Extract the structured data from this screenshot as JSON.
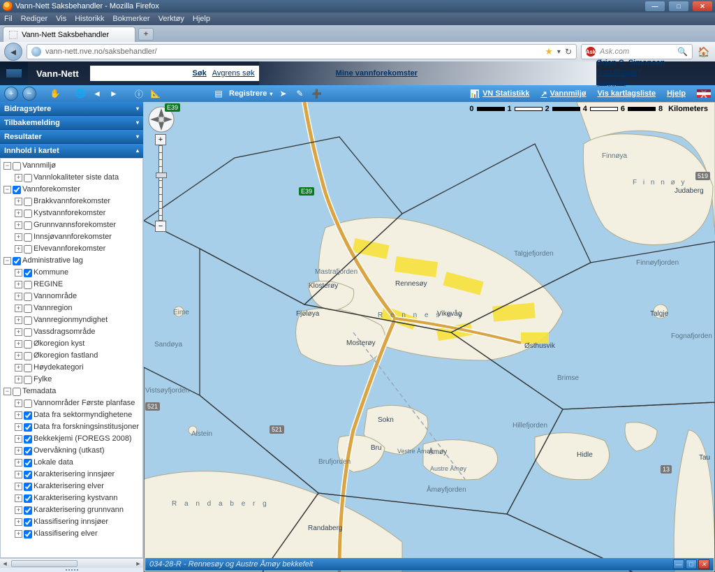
{
  "window": {
    "title": "Vann-Nett Saksbehandler - Mozilla Firefox"
  },
  "ff_menu": [
    "Fil",
    "Rediger",
    "Vis",
    "Historikk",
    "Bokmerker",
    "Verktøy",
    "Hjelp"
  ],
  "tab": {
    "title": "Vann-Nett Saksbehandler"
  },
  "url": "vann-nett.nve.no/saksbehandler/",
  "search_placeholder": "Ask.com",
  "banner": {
    "app": "Vann-Nett",
    "sok": "Søk",
    "avgrens": "Avgrens søk",
    "mine": "Mine vannforekomster"
  },
  "user": {
    "name": "Ørjan C. Simonsen",
    "settings": "Innstillinger",
    "logout": "Logg ut"
  },
  "toolbar": {
    "registrere": "Registrere",
    "vn_stat": "VN Statistikk",
    "vannmiljo": "Vannmiljø",
    "vis_kart": "Vis kartlagsliste",
    "hjelp": "Hjelp"
  },
  "accordion": {
    "bidrag": "Bidragsytere",
    "tilbake": "Tilbakemelding",
    "resultater": "Resultater",
    "innhold": "Innhold i kartet"
  },
  "tree": {
    "vannmiljo": "Vannmiljø",
    "vannlok": "Vannlokaliteter siste data",
    "vannforekomster": "Vannforekomster",
    "brakk": "Brakkvannforekomster",
    "kyst": "Kystvannforekomster",
    "grunn": "Grunnvannsforekomster",
    "innsjo": "Innsjøvannforekomster",
    "elve": "Elvevannforekomster",
    "admin": "Administrative lag",
    "kommune": "Kommune",
    "regine": "REGINE",
    "vannomrade": "Vannområde",
    "vannregion": "Vannregion",
    "vregmynd": "Vannregionmyndighet",
    "vassdrag": "Vassdragsområde",
    "okokyst": "Økoregion kyst",
    "okofastland": "Økoregion fastland",
    "hoyde": "Høydekategori",
    "fylke": "Fylke",
    "temadata": "Temadata",
    "vannomr_plan": "Vannområder Første planfase",
    "sektor": "Data fra sektormyndighetene",
    "forsk": "Data fra forskningsinstitusjoner",
    "bekke": "Bekkekjemi (FOREGS 2008)",
    "overvak": "Overvåkning (utkast)",
    "lokale": "Lokale data",
    "kar_innsjo": "Karakterisering innsjøer",
    "kar_elver": "Karakterisering elver",
    "kar_kyst": "Karakterisering kystvann",
    "kar_grunn": "Karakterisering grunnvann",
    "klas_innsjo": "Klassifisering innsjøer",
    "klas_elver": "Klassifisering elver"
  },
  "scale": {
    "ticks": [
      "0",
      "1",
      "2",
      "4",
      "6",
      "8"
    ],
    "unit": "Kilometers"
  },
  "status": {
    "text": "034-28-R - Rennesøy og Austre Åmøy bekkefelt"
  },
  "map_labels": {
    "finnoya": "Finnøya",
    "judaberg": "Judaberg",
    "finnoy": "F i n n ø y",
    "talgjefjorden": "Talgjefjorden",
    "finnoyfjorden": "Finnøyfjorden",
    "talgje": "Talgje",
    "fognafjorden": "Fognafjorden",
    "brimse": "Brimse",
    "osthusvik": "Østhusvik",
    "hillefjorden": "Hillefjorden",
    "hidle": "Hidle",
    "amoy": "Åmøy",
    "austre_amoy": "Austre Åmøy",
    "vestre_amoy": "Vestre Åmøy",
    "amoyfjorden": "Åmøyfjorden",
    "sokn": "Sokn",
    "bru": "Bru",
    "alstein": "Alstein",
    "vistsoyfjorden": "Vistsøyfjorden",
    "sandoya": "Sandøya",
    "eime": "Eime",
    "fjoloya": "Fjøløya",
    "klosteroy": "Klosterøy",
    "mastrafjorden": "Mastrafjorden",
    "rennesoy": "Rennesøy",
    "rennesoy_sp": "R e n n e s ø y",
    "vikevag": "Vikevåg",
    "mosteroy": "Mosterøy",
    "brufjorden": "Brufjorden",
    "randaberg": "R a n d a b e r g",
    "randaberg2": "Randaberg",
    "tau": "Tau"
  },
  "road_labels": {
    "e39a": "E39",
    "e39b": "E39",
    "r521a": "521",
    "r521b": "521",
    "r519": "519",
    "r13": "13"
  }
}
